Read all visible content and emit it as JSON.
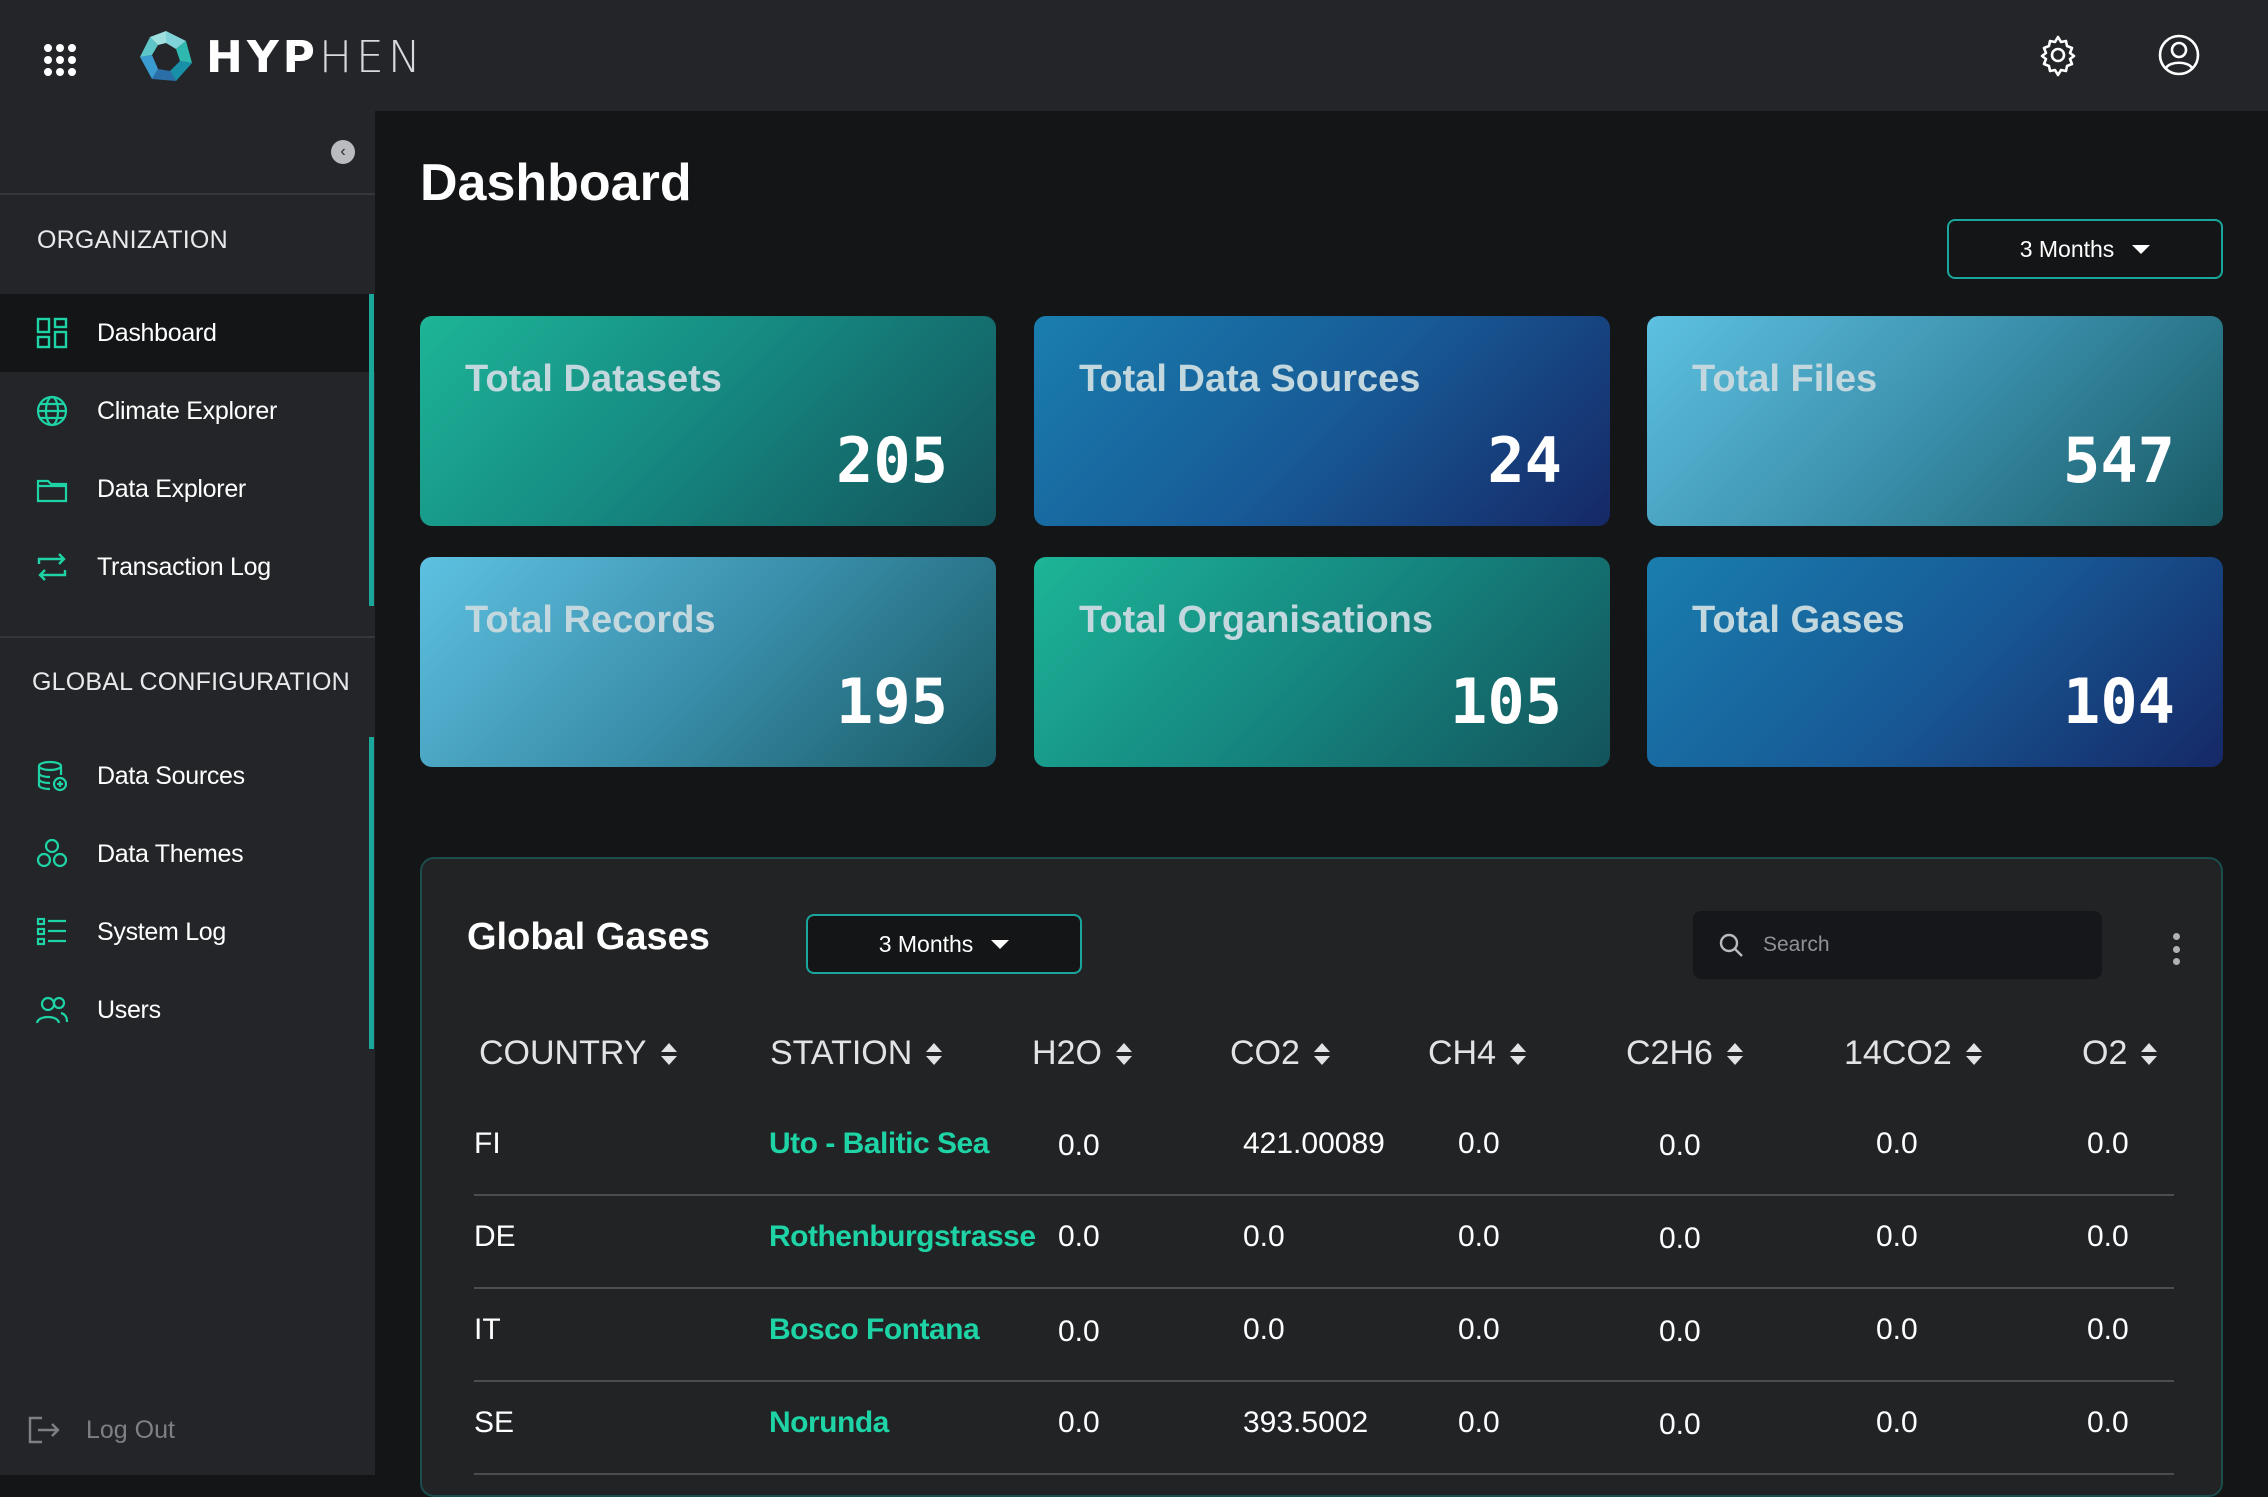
{
  "header": {
    "brand_bold": "HYP",
    "brand_light": "HEN",
    "apps_icon": "apps-grid-icon",
    "settings_icon": "gear-icon",
    "profile_icon": "user-circle-icon"
  },
  "sidebar": {
    "collapse_icon": "chevron-left-icon",
    "org_title": "ORGANIZATION",
    "org_items": [
      {
        "label": "Dashboard",
        "icon": "dashboard-icon"
      },
      {
        "label": "Climate Explorer",
        "icon": "globe-icon"
      },
      {
        "label": "Data Explorer",
        "icon": "folder-icon"
      },
      {
        "label": "Transaction Log",
        "icon": "transfer-icon"
      }
    ],
    "global_title": "GLOBAL CONFIGURATION",
    "global_items": [
      {
        "label": "Data Sources",
        "icon": "database-icon"
      },
      {
        "label": "Data Themes",
        "icon": "themes-icon"
      },
      {
        "label": "System Log",
        "icon": "list-icon"
      },
      {
        "label": "Users",
        "icon": "users-icon"
      }
    ],
    "logout_label": "Log Out",
    "accent_color": "#1aa69a"
  },
  "main": {
    "title": "Dashboard",
    "period": "3 Months",
    "cards": [
      {
        "title": "Total Datasets",
        "value": "205"
      },
      {
        "title": "Total Data Sources",
        "value": "24"
      },
      {
        "title": "Total Files",
        "value": "547"
      },
      {
        "title": "Total Records",
        "value": "195"
      },
      {
        "title": "Total Organisations",
        "value": "105"
      },
      {
        "title": "Total Gases",
        "value": "104"
      }
    ]
  },
  "gases": {
    "title": "Global Gases",
    "period": "3 Months",
    "search_placeholder": "Search",
    "columns": [
      "COUNTRY",
      "STATION",
      "H2O",
      "CO2",
      "CH4",
      "C2H6",
      "14CO2",
      "O2"
    ],
    "rows": [
      [
        "FI",
        "Uto - Balitic Sea",
        "0.0",
        "421.00089",
        "0.0",
        "0.0",
        "0.0",
        "0.0"
      ],
      [
        "DE",
        "Rothenburgstrasse",
        "0.0",
        "0.0",
        "0.0",
        "0.0",
        "0.0",
        "0.0"
      ],
      [
        "IT",
        "Bosco Fontana",
        "0.0",
        "0.0",
        "0.0",
        "0.0",
        "0.0",
        "0.0"
      ],
      [
        "SE",
        "Norunda",
        "0.0",
        "393.5002",
        "0.0",
        "0.0",
        "0.0",
        "0.0"
      ]
    ]
  }
}
